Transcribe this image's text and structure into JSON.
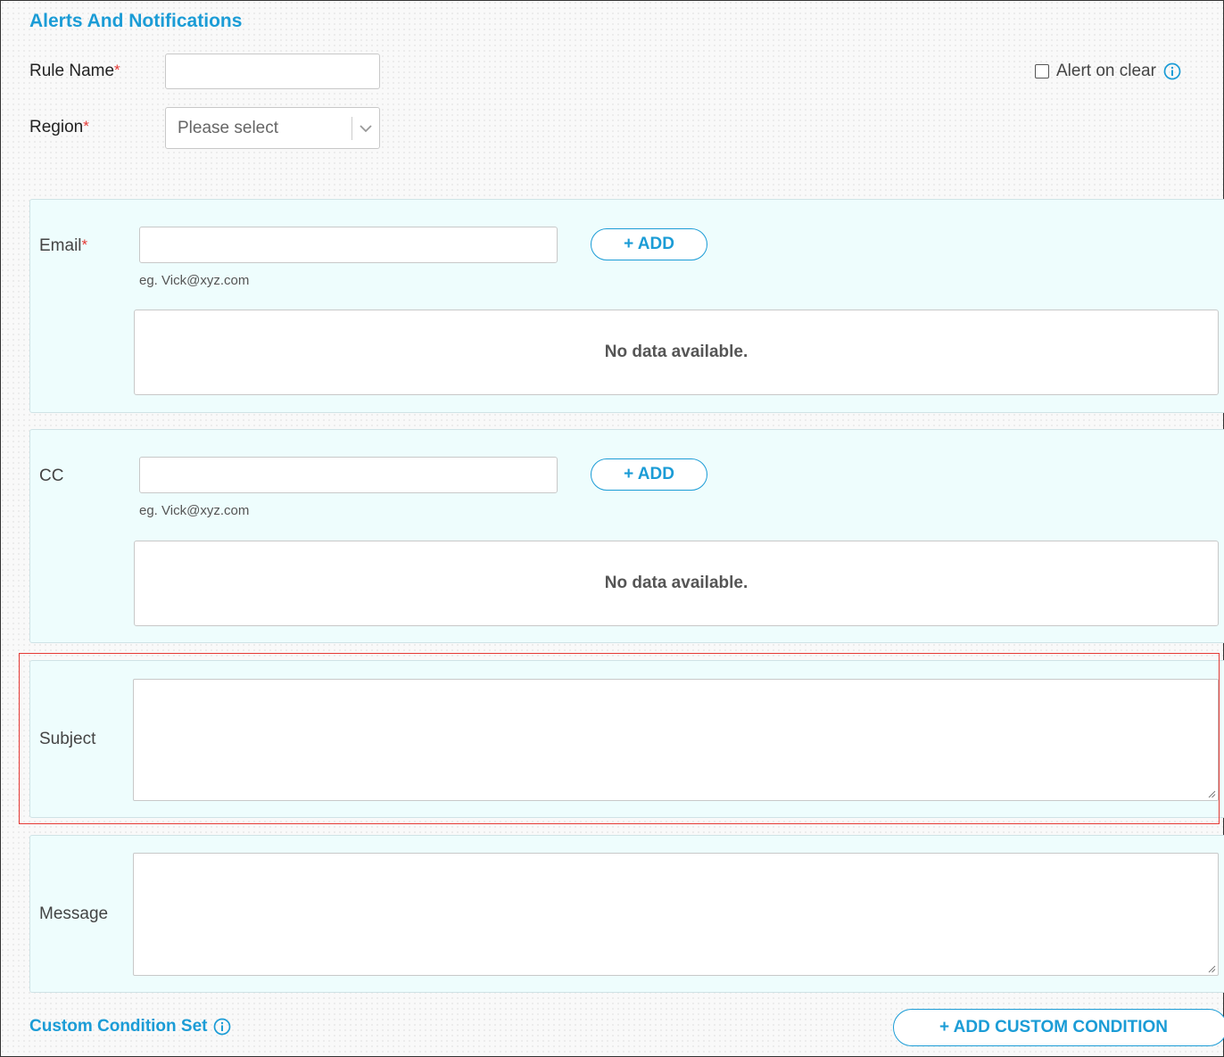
{
  "page": {
    "title": "Alerts And Notifications"
  },
  "form": {
    "rule_name_label": "Rule Name",
    "region_label": "Region",
    "required_mark": "*",
    "region_placeholder": "Please select",
    "alert_on_clear_label": "Alert on clear",
    "alert_on_clear_checked": false
  },
  "email_panel": {
    "label": "Email",
    "add_label": "+ ADD",
    "hint": "eg. Vick@xyz.com",
    "empty_text": "No data available."
  },
  "cc_panel": {
    "label": "CC",
    "add_label": "+ ADD",
    "hint": "eg. Vick@xyz.com",
    "empty_text": "No data available."
  },
  "subject_panel": {
    "label": "Subject"
  },
  "message_panel": {
    "label": "Message"
  },
  "custom": {
    "title": "Custom Condition Set",
    "add_label": "+ ADD CUSTOM CONDITION"
  },
  "colors": {
    "accent": "#1b9cd6",
    "required": "#e53935",
    "panel_bg": "#eefdfd",
    "highlight": "#e53935"
  },
  "icons": [
    "info-icon",
    "chevron-down-icon",
    "resize-grip-icon"
  ]
}
